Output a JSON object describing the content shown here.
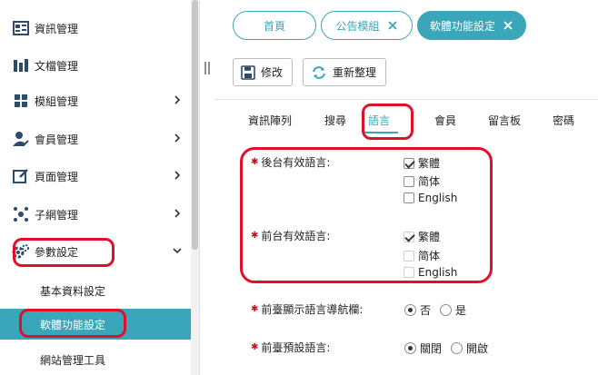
{
  "sidebar": {
    "items": [
      {
        "label": "資訊管理",
        "icon": "grid-list-icon",
        "has_chevron": false
      },
      {
        "label": "文檔管理",
        "icon": "chart-columns-icon",
        "has_chevron": false
      },
      {
        "label": "模組管理",
        "icon": "modules-grid-icon",
        "has_chevron": true
      },
      {
        "label": "會員管理",
        "icon": "user-check-icon",
        "has_chevron": true
      },
      {
        "label": "頁面管理",
        "icon": "edit-page-icon",
        "has_chevron": true
      },
      {
        "label": "子網管理",
        "icon": "network-icon",
        "has_chevron": true
      },
      {
        "label": "參數設定",
        "icon": "gears-icon",
        "has_chevron": true,
        "expanded": true
      }
    ],
    "subitems": [
      {
        "label": "基本資料設定",
        "active": false
      },
      {
        "label": "軟體功能設定",
        "active": true
      },
      {
        "label": "網站管理工具",
        "active": false
      }
    ]
  },
  "tabs": [
    {
      "label": "首頁",
      "closable": false,
      "active": false
    },
    {
      "label": "公告模組",
      "closable": true,
      "active": false
    },
    {
      "label": "軟體功能設定",
      "closable": true,
      "active": true
    }
  ],
  "toolbar": {
    "edit_label": "修改",
    "refresh_label": "重新整理"
  },
  "subtabs": [
    "資訊陣列",
    "搜尋",
    "語言",
    "會員",
    "留言板",
    "密碼"
  ],
  "active_subtab": "語言",
  "form": {
    "backend_lang": {
      "label": "後台有效語言:",
      "options": [
        {
          "text": "繁體",
          "checked": true,
          "disabled": false
        },
        {
          "text": "简体",
          "checked": false,
          "disabled": false
        },
        {
          "text": "English",
          "checked": false,
          "disabled": false
        }
      ]
    },
    "frontend_lang": {
      "label": "前台有效語言:",
      "options": [
        {
          "text": "繁體",
          "checked": true,
          "disabled": true
        },
        {
          "text": "简体",
          "checked": false,
          "disabled": true
        },
        {
          "text": "English",
          "checked": false,
          "disabled": true
        }
      ]
    },
    "show_lang_nav": {
      "label": "前臺顯示語言導航欄:",
      "options": [
        {
          "text": "否",
          "selected": true
        },
        {
          "text": "是",
          "selected": false
        }
      ]
    },
    "default_lang": {
      "label": "前臺預設語言:",
      "options": [
        {
          "text": "關閉",
          "selected": true
        },
        {
          "text": "開啟",
          "selected": false
        }
      ]
    }
  },
  "colors": {
    "accent": "#3aa6b9",
    "annotation": "#e0102a",
    "required": "#c0142e"
  }
}
